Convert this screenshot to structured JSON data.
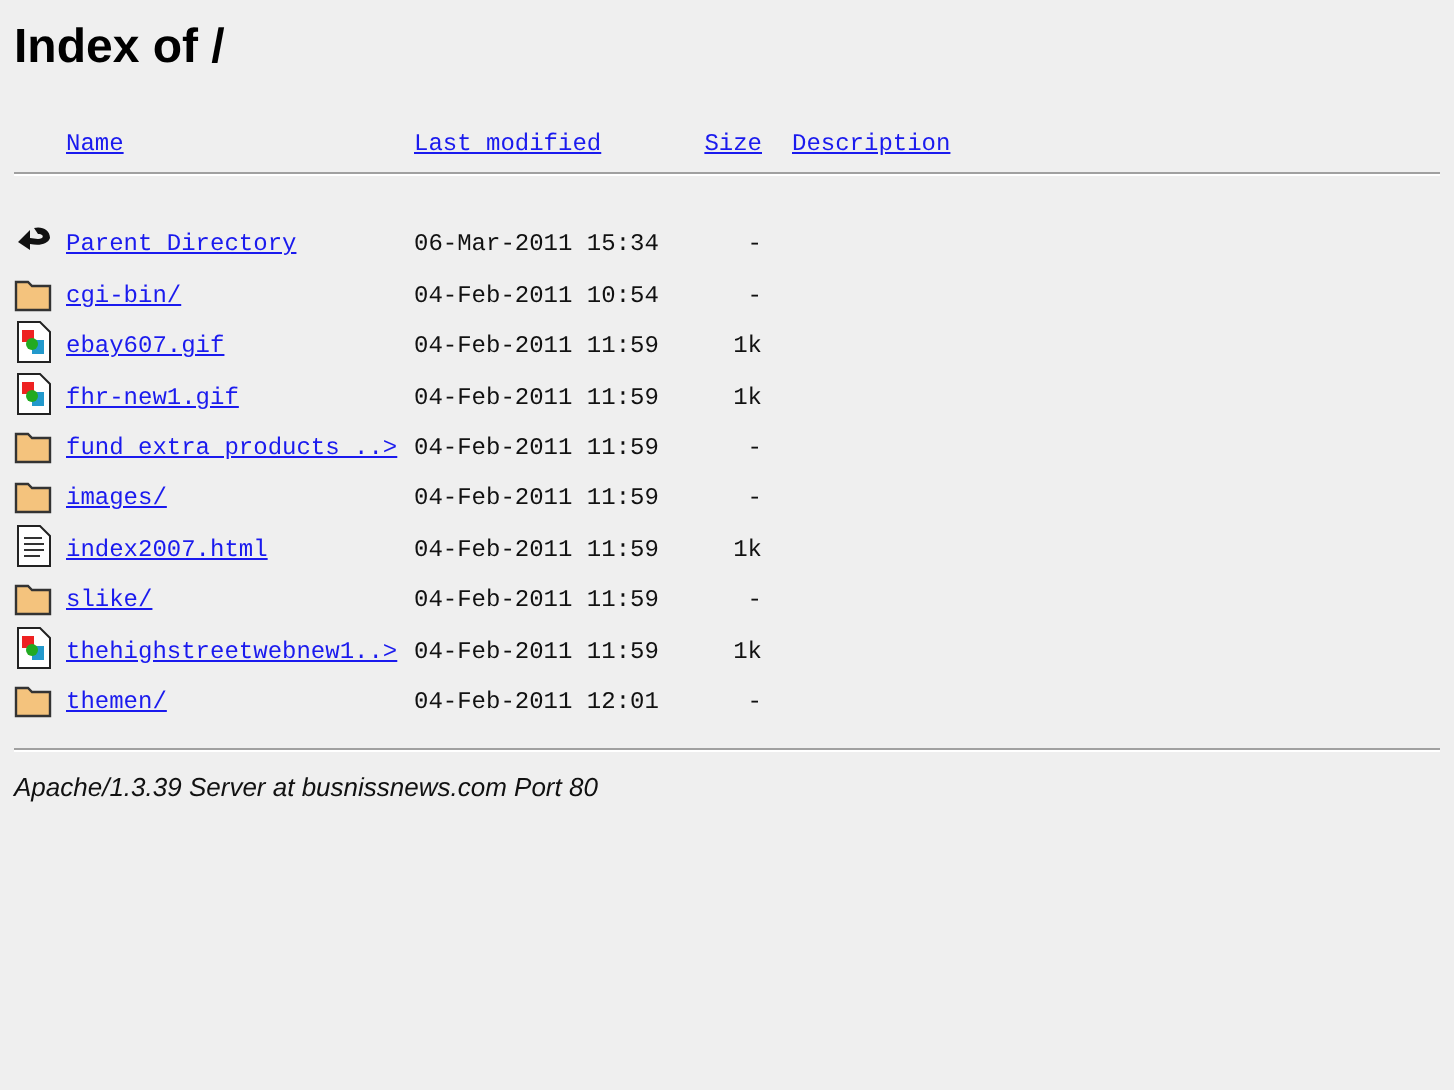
{
  "title": "Index of /",
  "columns": [
    "Name",
    "Last modified",
    "Size",
    "Description"
  ],
  "rows": [
    {
      "kind": "back",
      "name": "Parent Directory",
      "modified": "06-Mar-2011 15:34",
      "size": "-"
    },
    {
      "kind": "folder",
      "name": "cgi-bin/",
      "modified": "04-Feb-2011 10:54",
      "size": "-"
    },
    {
      "kind": "image",
      "name": "ebay607.gif",
      "modified": "04-Feb-2011 11:59",
      "size": "1k"
    },
    {
      "kind": "image",
      "name": "fhr-new1.gif",
      "modified": "04-Feb-2011 11:59",
      "size": "1k"
    },
    {
      "kind": "folder",
      "name": "fund extra products ..>",
      "modified": "04-Feb-2011 11:59",
      "size": "-"
    },
    {
      "kind": "folder",
      "name": "images/",
      "modified": "04-Feb-2011 11:59",
      "size": "-"
    },
    {
      "kind": "text",
      "name": "index2007.html",
      "modified": "04-Feb-2011 11:59",
      "size": "1k"
    },
    {
      "kind": "folder",
      "name": "slike/",
      "modified": "04-Feb-2011 11:59",
      "size": "-"
    },
    {
      "kind": "image",
      "name": "thehighstreetwebnew1..>",
      "modified": "04-Feb-2011 11:59",
      "size": "1k"
    },
    {
      "kind": "folder",
      "name": "themen/",
      "modified": "04-Feb-2011 12:01",
      "size": "-"
    }
  ],
  "footer": "Apache/1.3.39 Server at busnissnews.com Port 80"
}
